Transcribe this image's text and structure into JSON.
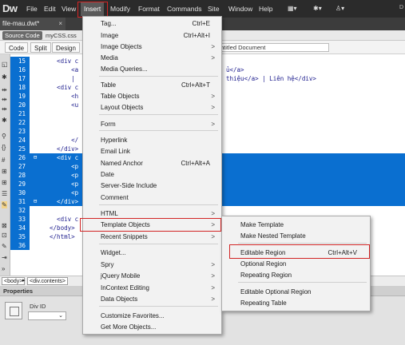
{
  "app": {
    "logo": "Dw",
    "menus": [
      "File",
      "Edit",
      "View",
      "Insert",
      "Modify",
      "Format",
      "Commands",
      "Site",
      "Window",
      "Help"
    ],
    "active_menu": "Insert",
    "corner_text": "D"
  },
  "document": {
    "tab_title": "file-mau.dwt*",
    "tab_close": "×",
    "source_label": "Source Code",
    "css_file": "myCSS.css",
    "view_buttons": [
      "Code",
      "Split",
      "Design"
    ],
    "title_value": "ntitled Document"
  },
  "code_lines": [
    {
      "n": "15",
      "fold": "",
      "code": "    <div c",
      "tail": "",
      "selected": false
    },
    {
      "n": "16",
      "fold": "",
      "code": "        <a",
      "tail": "ủ</a>",
      "selected": false
    },
    {
      "n": "17",
      "fold": "",
      "code": "        |",
      "tail": "thiệu</a> | Liên hệ</div>",
      "selected": false
    },
    {
      "n": "18",
      "fold": "",
      "code": "    <div c",
      "tail": "",
      "selected": false
    },
    {
      "n": "19",
      "fold": "",
      "code": "        <h",
      "tail": "",
      "selected": false
    },
    {
      "n": "20",
      "fold": "",
      "code": "        <u",
      "tail": "",
      "selected": false
    },
    {
      "n": "21",
      "fold": "",
      "code": "",
      "tail": "",
      "selected": false
    },
    {
      "n": "22",
      "fold": "",
      "code": "",
      "tail": "",
      "selected": false
    },
    {
      "n": "23",
      "fold": "",
      "code": "",
      "tail": "",
      "selected": false
    },
    {
      "n": "24",
      "fold": "",
      "code": "        </",
      "tail": "",
      "selected": false
    },
    {
      "n": "25",
      "fold": "",
      "code": "    </div>",
      "tail": "",
      "selected": false
    },
    {
      "n": "26",
      "fold": "⊟",
      "code": "    <div c",
      "tail": "",
      "selected": true
    },
    {
      "n": "27",
      "fold": "",
      "code": "        <p",
      "tail": "",
      "selected": true
    },
    {
      "n": "28",
      "fold": "",
      "code": "        <p",
      "tail": "",
      "selected": true
    },
    {
      "n": "29",
      "fold": "",
      "code": "        <p",
      "tail": "",
      "selected": true
    },
    {
      "n": "30",
      "fold": "",
      "code": "        <p",
      "tail": "",
      "selected": true
    },
    {
      "n": "31",
      "fold": "⊟",
      "code": "    </div>",
      "tail": "",
      "selected": true
    },
    {
      "n": "32",
      "fold": "",
      "code": "",
      "tail": "",
      "selected": false
    },
    {
      "n": "33",
      "fold": "",
      "code": "    <div c",
      "tail": "",
      "selected": false
    },
    {
      "n": "34",
      "fold": "",
      "code": "  </body>",
      "tail": "",
      "selected": false
    },
    {
      "n": "35",
      "fold": "",
      "code": "  </html>",
      "tail": "",
      "selected": false
    },
    {
      "n": "36",
      "fold": "",
      "code": "",
      "tail": "",
      "selected": false
    }
  ],
  "status": {
    "tags": [
      "<body>",
      "<div.contents>"
    ],
    "separator": "▸"
  },
  "properties": {
    "header": "Properties",
    "div_id_label": "Div ID",
    "div_select_arrow": "⌄"
  },
  "insert_menu": {
    "items": [
      {
        "label": "Tag...",
        "shortcut": "Ctrl+E",
        "arrow": ""
      },
      {
        "label": "Image",
        "shortcut": "Ctrl+Alt+I",
        "arrow": ""
      },
      {
        "label": "Image Objects",
        "shortcut": "",
        "arrow": ">"
      },
      {
        "label": "Media",
        "shortcut": "",
        "arrow": ">"
      },
      {
        "label": "Media Queries...",
        "shortcut": "",
        "arrow": ""
      },
      {
        "label": "Table",
        "shortcut": "Ctrl+Alt+T",
        "arrow": ""
      },
      {
        "label": "Table Objects",
        "shortcut": "",
        "arrow": ">"
      },
      {
        "label": "Layout Objects",
        "shortcut": "",
        "arrow": ">"
      },
      {
        "label": "Form",
        "shortcut": "",
        "arrow": ">"
      },
      {
        "label": "Hyperlink",
        "shortcut": "",
        "arrow": ""
      },
      {
        "label": "Email Link",
        "shortcut": "",
        "arrow": ""
      },
      {
        "label": "Named Anchor",
        "shortcut": "Ctrl+Alt+A",
        "arrow": ""
      },
      {
        "label": "Date",
        "shortcut": "",
        "arrow": ""
      },
      {
        "label": "Server-Side Include",
        "shortcut": "",
        "arrow": ""
      },
      {
        "label": "Comment",
        "shortcut": "",
        "arrow": ""
      },
      {
        "label": "HTML",
        "shortcut": "",
        "arrow": ">"
      },
      {
        "label": "Template Objects",
        "shortcut": "",
        "arrow": ">"
      },
      {
        "label": "Recent Snippets",
        "shortcut": "",
        "arrow": ">"
      },
      {
        "label": "Widget...",
        "shortcut": "",
        "arrow": ""
      },
      {
        "label": "Spry",
        "shortcut": "",
        "arrow": ">"
      },
      {
        "label": "jQuery Mobile",
        "shortcut": "",
        "arrow": ">"
      },
      {
        "label": "InContext Editing",
        "shortcut": "",
        "arrow": ">"
      },
      {
        "label": "Data Objects",
        "shortcut": "",
        "arrow": ">"
      },
      {
        "label": "Customize Favorites...",
        "shortcut": "",
        "arrow": ""
      },
      {
        "label": "Get More Objects...",
        "shortcut": "",
        "arrow": ""
      }
    ]
  },
  "template_submenu": {
    "items": [
      {
        "label": "Make Template",
        "shortcut": ""
      },
      {
        "label": "Make Nested Template",
        "shortcut": ""
      },
      {
        "label": "Editable Region",
        "shortcut": "Ctrl+Alt+V"
      },
      {
        "label": "Optional Region",
        "shortcut": ""
      },
      {
        "label": "Repeating Region",
        "shortcut": ""
      },
      {
        "label": "Editable Optional Region",
        "shortcut": ""
      },
      {
        "label": "Repeating Table",
        "shortcut": ""
      }
    ]
  },
  "colors": {
    "selection": "#0a6fd0",
    "highlight_box": "#d22424",
    "menubar": "#2b2b2b"
  }
}
